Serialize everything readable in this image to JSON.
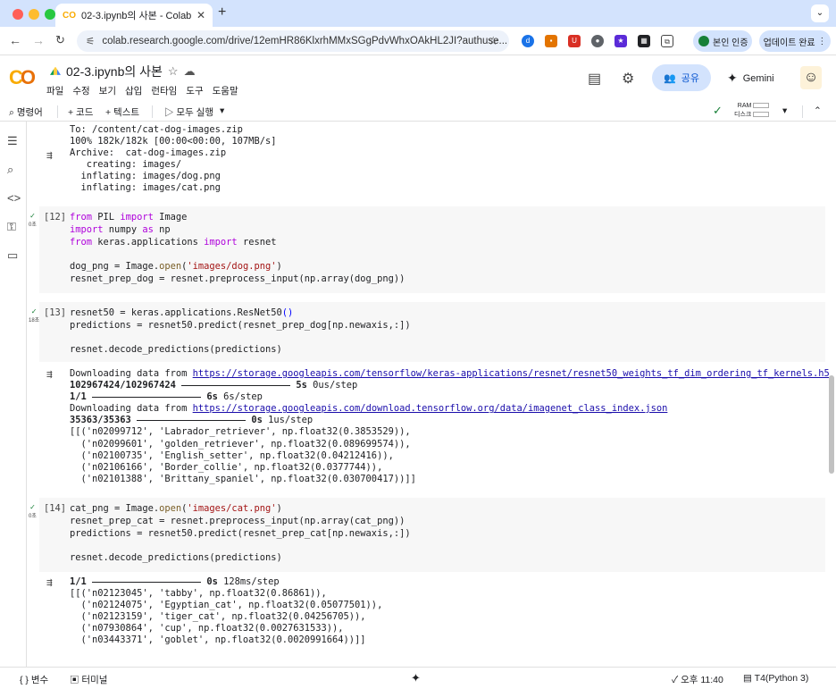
{
  "browser": {
    "tab_title": "02-3.ipynb의 사본 - Colab",
    "url": "colab.research.google.com/drive/12emHR86KlxrhMMxSGgPdvWhxOAkHL2JI?authuse...",
    "verify_label": "본인 인증",
    "update_label": "업데이트 완료"
  },
  "header": {
    "file_name": "02-3.ipynb의 사본",
    "menus": [
      "파일",
      "수정",
      "보기",
      "삽입",
      "런타임",
      "도구",
      "도움말"
    ],
    "share_label": "공유",
    "gemini_label": "Gemini"
  },
  "toolbar": {
    "command": "명령어",
    "code": "+ 코드",
    "text": "+ 텍스트",
    "run_all": "▷ 모두 실행",
    "ram": "RAM",
    "disk": "디스크"
  },
  "cells": [
    {
      "output": [
        "To: /content/cat-dog-images.zip",
        "100% 182k/182k [00:00<00:00, 107MB/s]",
        "Archive:  cat-dog-images.zip",
        "   creating: images/",
        "  inflating: images/dog.png",
        "  inflating: images/cat.png"
      ]
    },
    {
      "prompt": "[12]",
      "time": "0초"
    },
    {
      "prompt": "[13]",
      "time": "18초",
      "output_url1": "https://storage.googleapis.com/tensorflow/keras-applications/resnet/resnet50_weights_tf_dim_ordering_tf_kernels.h5",
      "output_url2": "https://storage.googleapis.com/download.tensorflow.org/data/imagenet_class_index.json",
      "dl_label": "Downloading data from ",
      "p1_count": "102967424/102967424",
      "p1_time": "5s",
      "p1_rate": "0us/step",
      "p2_count": "1/1",
      "p2_time": "6s",
      "p2_rate": "6s/step",
      "p3_count": "35363/35363",
      "p3_time": "0s",
      "p3_rate": "1us/step",
      "result": [
        "[[('n02099712', 'Labrador_retriever', np.float32(0.3853529)),",
        "  ('n02099601', 'golden_retriever', np.float32(0.089699574)),",
        "  ('n02100735', 'English_setter', np.float32(0.04212416)),",
        "  ('n02106166', 'Border_collie', np.float32(0.0377744)),",
        "  ('n02101388', 'Brittany_spaniel', np.float32(0.030700417))]]"
      ]
    },
    {
      "prompt": "[14]",
      "time": "0초",
      "p_count": "1/1",
      "p_time": "0s",
      "p_rate": "128ms/step",
      "result": [
        "[[('n02123045', 'tabby', np.float32(0.86861)),",
        "  ('n02124075', 'Egyptian_cat', np.float32(0.05077501)),",
        "  ('n02123159', 'tiger_cat', np.float32(0.04256705)),",
        "  ('n07930864', 'cup', np.float32(0.0027631533)),",
        "  ('n03443371', 'goblet', np.float32(0.0020991664))]]"
      ]
    }
  ],
  "status": {
    "variables": "변수",
    "terminal": "터미널",
    "time": "오후 11:40",
    "runtime": "T4(Python 3)"
  }
}
